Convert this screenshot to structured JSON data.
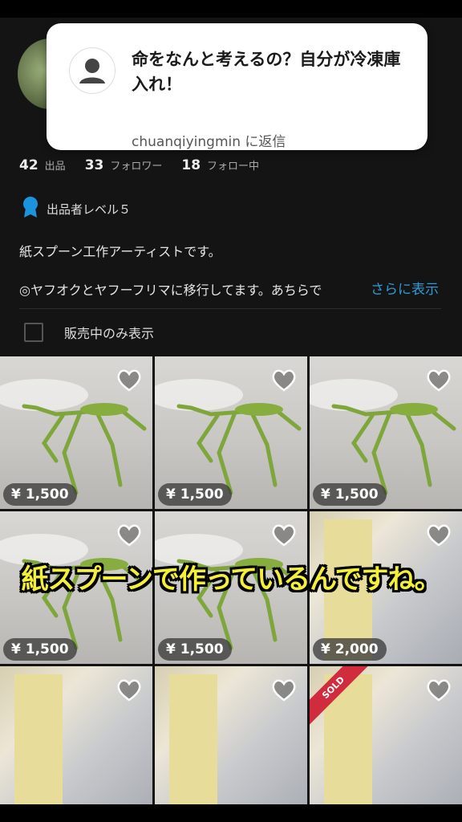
{
  "notification": {
    "message": "命をなんと考えるの？自分が冷凍庫入れ！",
    "reply_to": "chuanqiyingmin に返信"
  },
  "stats": [
    {
      "num": "42",
      "label": "出品"
    },
    {
      "num": "33",
      "label": "フォロワー"
    },
    {
      "num": "18",
      "label": "フォロー中"
    }
  ],
  "level": {
    "label": "出品者レベル５",
    "badge_color": "#1c93dd"
  },
  "bio": {
    "line1": "紙スプーン工作アーティストです。",
    "line2": "◎ヤフオクとヤフーフリマに移行してます。あちらで",
    "more": "さらに表示"
  },
  "filter": {
    "label": "販売中のみ表示",
    "checked": false
  },
  "items": [
    {
      "price": "¥ 1,500",
      "type": "mantis",
      "sold": false
    },
    {
      "price": "¥ 1,500",
      "type": "mantis",
      "sold": false
    },
    {
      "price": "¥ 1,500",
      "type": "mantis",
      "sold": false
    },
    {
      "price": "¥ 1,500",
      "type": "mantis",
      "sold": false
    },
    {
      "price": "¥ 1,500",
      "type": "mantis",
      "sold": false
    },
    {
      "price": "¥ 2,000",
      "type": "poster",
      "sold": false
    },
    {
      "price": "",
      "type": "poster",
      "sold": false
    },
    {
      "price": "",
      "type": "poster",
      "sold": false
    },
    {
      "price": "",
      "type": "poster",
      "sold": true,
      "sold_label": "SOLD"
    }
  ],
  "caption": "紙スプーンで作っているんですね。"
}
